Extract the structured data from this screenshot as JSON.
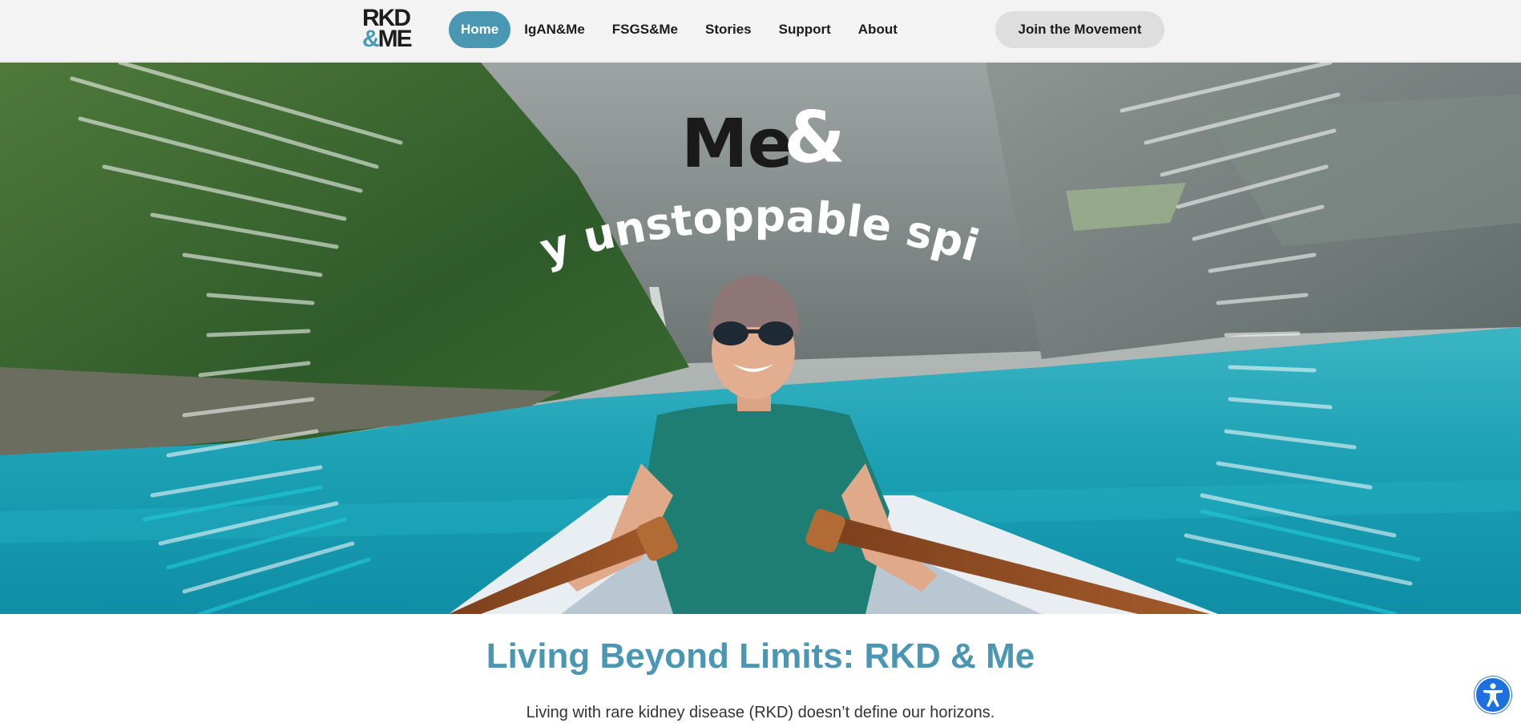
{
  "header": {
    "logo": {
      "line1": "RKD",
      "line2_amp": "&",
      "line2_me": "ME"
    },
    "nav": [
      {
        "label": "Home",
        "active": true
      },
      {
        "label": "IgAN&Me",
        "active": false
      },
      {
        "label": "FSGS&Me",
        "active": false
      },
      {
        "label": "Stories",
        "active": false
      },
      {
        "label": "Support",
        "active": false
      },
      {
        "label": "About",
        "active": false
      }
    ],
    "cta_label": "Join the Movement"
  },
  "hero": {
    "title_me": "Me",
    "title_amp": "&",
    "tagline": "my unstoppable spirit"
  },
  "content": {
    "heading": "Living Beyond Limits: RKD & Me",
    "intro": "Living with rare kidney disease (RKD) doesn’t define our horizons."
  },
  "colors": {
    "brand": "#4a97b3",
    "header_bg": "#f3f3f3",
    "accessibility": "#1e6fe0"
  },
  "icons": {
    "accessibility_button": "accessibility-icon"
  }
}
